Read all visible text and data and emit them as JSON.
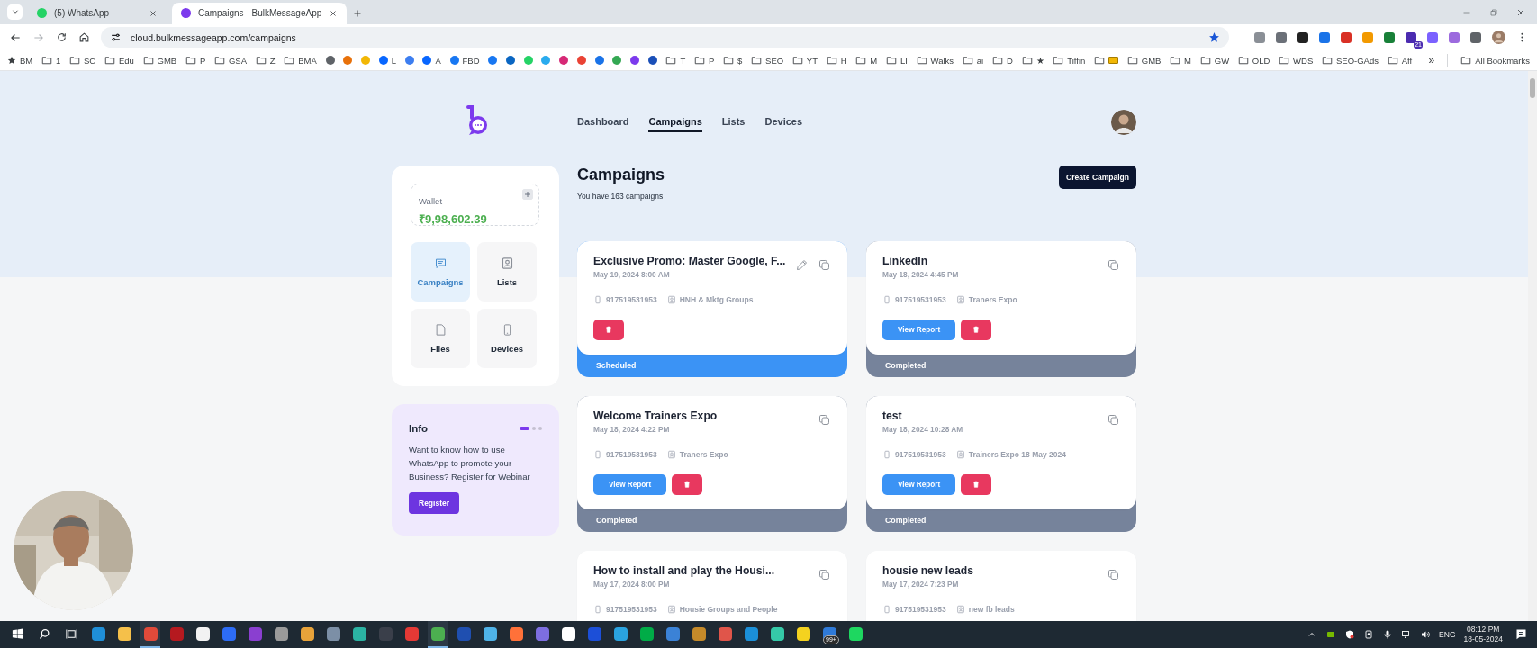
{
  "browser": {
    "tabs": [
      {
        "title": "(5) WhatsApp",
        "selected": false,
        "color": "#25d366"
      },
      {
        "title": "Campaigns - BulkMessageApp",
        "selected": true,
        "color": "#7c3aed"
      }
    ],
    "address": "cloud.bulkmessageapp.com/campaigns",
    "extensions": [
      {
        "color": "#8a8f96"
      },
      {
        "color": "#6b7078"
      },
      {
        "color": "#222222"
      },
      {
        "color": "#1a73e8"
      },
      {
        "color": "#d93025"
      },
      {
        "color": "#f29900"
      },
      {
        "color": "#188038"
      },
      {
        "color": "#4b2bb0",
        "badge": "21"
      },
      {
        "color": "#7b61ff"
      },
      {
        "color": "#9c6ade"
      },
      {
        "color": "#5f6368"
      }
    ],
    "bookmarks": [
      {
        "kind": "star",
        "label": "BM"
      },
      {
        "kind": "folder",
        "label": "1"
      },
      {
        "kind": "folder",
        "label": "SC"
      },
      {
        "kind": "folder",
        "label": "Edu"
      },
      {
        "kind": "folder",
        "label": "GMB"
      },
      {
        "kind": "folder",
        "label": "P"
      },
      {
        "kind": "folder",
        "label": "GSA"
      },
      {
        "kind": "folder",
        "label": "Z"
      },
      {
        "kind": "folder",
        "label": "BMA"
      },
      {
        "kind": "site",
        "color": "#5f6368"
      },
      {
        "kind": "site",
        "color": "#e8710a"
      },
      {
        "kind": "site",
        "color": "#f2b705"
      },
      {
        "kind": "site",
        "color": "#0866ff",
        "label": "L"
      },
      {
        "kind": "site",
        "color": "#3d7ef0"
      },
      {
        "kind": "site",
        "color": "#0866ff",
        "label": "A"
      },
      {
        "kind": "site",
        "color": "#1877f2",
        "label": "FBD"
      },
      {
        "kind": "site",
        "color": "#1877f2"
      },
      {
        "kind": "site",
        "color": "#0a66c2"
      },
      {
        "kind": "site",
        "color": "#25d366"
      },
      {
        "kind": "site",
        "color": "#2aabee"
      },
      {
        "kind": "site",
        "color": "#d62976"
      },
      {
        "kind": "site",
        "color": "#ea4335"
      },
      {
        "kind": "site",
        "color": "#1a73e8"
      },
      {
        "kind": "site",
        "color": "#34a853"
      },
      {
        "kind": "site",
        "color": "#7c3aed"
      },
      {
        "kind": "site",
        "color": "#1a4fb8"
      },
      {
        "kind": "folder",
        "label": "T"
      },
      {
        "kind": "folder",
        "label": "P"
      },
      {
        "kind": "folder",
        "label": "$"
      },
      {
        "kind": "folder",
        "label": "SEO"
      },
      {
        "kind": "folder",
        "label": "YT"
      },
      {
        "kind": "folder",
        "label": "H"
      },
      {
        "kind": "folder",
        "label": "M"
      },
      {
        "kind": "folder",
        "label": "LI"
      },
      {
        "kind": "folder",
        "label": "Walks"
      },
      {
        "kind": "folder",
        "label": "ai"
      },
      {
        "kind": "folder",
        "label": "D"
      },
      {
        "kind": "folder",
        "label": "★"
      },
      {
        "kind": "folder",
        "label": "Tiffin"
      },
      {
        "kind": "folder-card"
      },
      {
        "kind": "folder",
        "label": "GMB"
      },
      {
        "kind": "folder",
        "label": "M"
      },
      {
        "kind": "folder",
        "label": "GW"
      },
      {
        "kind": "folder",
        "label": "OLD"
      },
      {
        "kind": "folder",
        "label": "WDS"
      },
      {
        "kind": "folder",
        "label": "SEO-GAds"
      },
      {
        "kind": "folder",
        "label": "Aff"
      }
    ],
    "bookmarks_overflow": "»",
    "all_bookmarks": "All Bookmarks"
  },
  "app": {
    "nav": [
      {
        "label": "Dashboard",
        "selected": false
      },
      {
        "label": "Campaigns",
        "selected": true
      },
      {
        "label": "Lists",
        "selected": false
      },
      {
        "label": "Devices",
        "selected": false
      }
    ],
    "wallet": {
      "label": "Wallet",
      "amount": "₹9,98,602.39"
    },
    "menu": [
      {
        "kind": "campaigns",
        "label": "Campaigns",
        "selected": true
      },
      {
        "kind": "lists",
        "label": "Lists",
        "selected": false
      },
      {
        "kind": "files",
        "label": "Files",
        "selected": false
      },
      {
        "kind": "devices",
        "label": "Devices",
        "selected": false
      }
    ],
    "info": {
      "title": "Info",
      "slides": [
        {
          "selected": true
        },
        {
          "selected": false
        },
        {
          "selected": false
        }
      ],
      "text": "Want to know how to use WhatsApp to promote your Business? Register for Webinar",
      "button": "Register"
    },
    "heading": "Campaigns",
    "subtitle": "You have 163 campaigns",
    "create_button": "Create Campaign",
    "campaigns": [
      {
        "title": "Exclusive Promo: Master Google, F...",
        "date": "May 19, 2024 8:00 AM",
        "phone": "917519531953",
        "group": "HNH & Mktg Groups",
        "editable": true,
        "actions": [
          {
            "kind": "delete"
          }
        ],
        "status": "Scheduled",
        "color": "#3b93f5"
      },
      {
        "title": "LinkedIn",
        "date": "May 18, 2024 4:45 PM",
        "phone": "917519531953",
        "group": "Traners Expo",
        "editable": false,
        "actions": [
          {
            "kind": "report",
            "label": "View Report"
          },
          {
            "kind": "delete"
          }
        ],
        "status": "Completed",
        "color": "#76839b"
      },
      {
        "title": "Welcome Trainers Expo",
        "date": "May 18, 2024 4:22 PM",
        "phone": "917519531953",
        "group": "Traners Expo",
        "editable": false,
        "actions": [
          {
            "kind": "report",
            "label": "View Report"
          },
          {
            "kind": "delete"
          }
        ],
        "status": "Completed",
        "color": "#76839b"
      },
      {
        "title": "test",
        "date": "May 18, 2024 10:28 AM",
        "phone": "917519531953",
        "group": "Trainers Expo 18 May 2024",
        "editable": false,
        "actions": [
          {
            "kind": "report",
            "label": "View Report"
          },
          {
            "kind": "delete"
          }
        ],
        "status": "Completed",
        "color": "#76839b"
      },
      {
        "title": "How to install and play the Housi...",
        "date": "May 17, 2024 8:00 PM",
        "phone": "917519531953",
        "group": "Housie Groups and People",
        "editable": false
      },
      {
        "title": "housie new leads",
        "date": "May 17, 2024 7:23 PM",
        "phone": "917519531953",
        "group": "new fb leads",
        "editable": false
      }
    ]
  },
  "taskbar": {
    "apps": [
      {
        "color": "#1f8fd8",
        "running": false
      },
      {
        "color": "#f5c04a",
        "running": false
      },
      {
        "color": "#e04a3a",
        "running": true
      },
      {
        "color": "#b5191f",
        "running": false
      },
      {
        "color": "#f2f2f2",
        "running": false
      },
      {
        "color": "#2d6cf5",
        "running": false
      },
      {
        "color": "#8a3fd0",
        "running": false
      },
      {
        "color": "#9a9a9a",
        "running": false
      },
      {
        "color": "#e8a33a",
        "running": false
      },
      {
        "color": "#7c8fa6",
        "running": false
      },
      {
        "color": "#2bb3a3",
        "running": false
      },
      {
        "color": "#3a3f4a",
        "running": false
      },
      {
        "color": "#e53935",
        "running": false
      },
      {
        "color": "#4caf50",
        "running": true
      },
      {
        "color": "#1f4fb0",
        "running": false
      },
      {
        "color": "#4fb3e8",
        "running": false
      },
      {
        "color": "#ff7139",
        "running": false
      },
      {
        "color": "#7d6ee0",
        "running": false
      },
      {
        "color": "#ffffff",
        "running": false
      },
      {
        "color": "#1c4fd8",
        "running": false
      },
      {
        "color": "#2aa3e0",
        "running": false
      },
      {
        "color": "#00ac47",
        "running": false
      },
      {
        "color": "#3b82d6",
        "running": false
      },
      {
        "color": "#c58a2a",
        "running": false
      },
      {
        "color": "#e0554a",
        "running": false
      },
      {
        "color": "#1b8fd8",
        "running": false
      },
      {
        "color": "#35c9a8",
        "running": false
      },
      {
        "color": "#f4d21f",
        "running": false
      },
      {
        "color": "#2f7ad8",
        "running": false,
        "badge": "99+"
      },
      {
        "color": "#1ed760",
        "running": false
      }
    ],
    "language": "ENG",
    "time": "08:12 PM",
    "date": "18-05-2024"
  }
}
